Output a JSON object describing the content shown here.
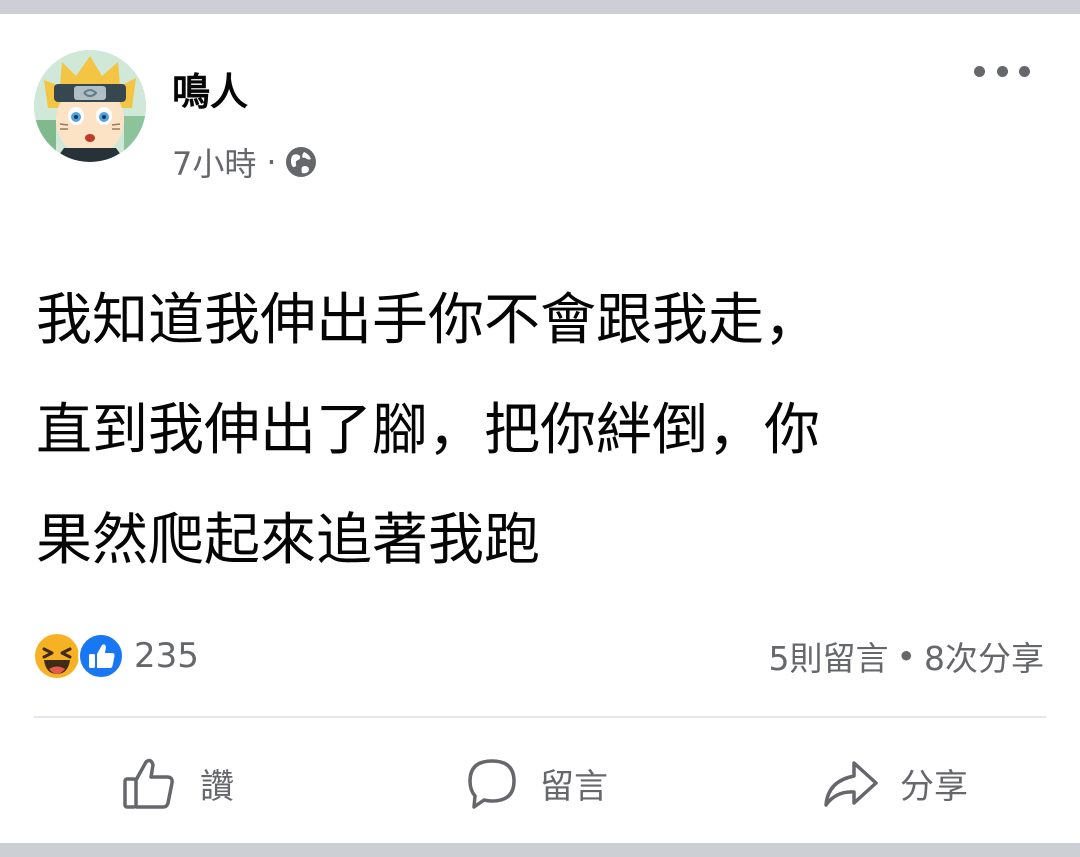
{
  "post": {
    "author": "鳴人",
    "time": "7小時",
    "separator": "·",
    "privacy_icon": "globe-icon",
    "more_icon": "more-options-icon",
    "text_lines": [
      "我知道我伸出手你不會跟我走，",
      "直到我伸出了腳，把你絆倒，你",
      "果然爬起來追著我跑"
    ]
  },
  "reactions": {
    "icons": [
      "haha-icon",
      "like-icon"
    ],
    "count": "235"
  },
  "stats": {
    "comments": "5則留言",
    "separator": "•",
    "shares": "8次分享"
  },
  "actions": {
    "like_label": "讚",
    "comment_label": "留言",
    "share_label": "分享"
  },
  "colors": {
    "background": "#ccd0d5",
    "card": "#ffffff",
    "text_primary": "#050505",
    "text_secondary": "#65676b",
    "like_blue": "#1877f2",
    "haha_yellow": "#f7b125",
    "divider": "#e4e6eb"
  }
}
